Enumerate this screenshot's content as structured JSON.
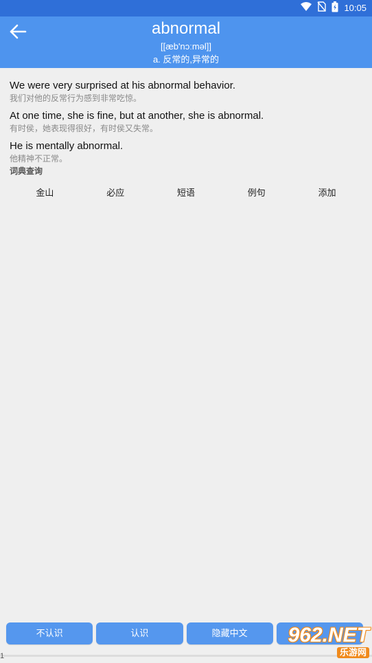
{
  "status_bar": {
    "time": "10:05",
    "icons": [
      "wifi-icon",
      "no-sim-icon",
      "battery-icon"
    ]
  },
  "header": {
    "word": "abnormal",
    "phonetic": "[[æb'nɔːməl]]",
    "definition": "a. 反常的,异常的"
  },
  "examples": [
    {
      "en": "We were very surprised at his abnormal behavior.",
      "zh": "我们对他的反常行为感到非常吃惊。"
    },
    {
      "en": "At one time, she is fine, but at another, she is abnormal.",
      "zh": "有时侯，她表现得很好，有时侯又失常。"
    },
    {
      "en": "He is mentally abnormal.",
      "zh": "他精神不正常。"
    }
  ],
  "dictionary": {
    "heading": "词典查询",
    "tabs": [
      "金山",
      "必应",
      "短语",
      "例句",
      "添加"
    ]
  },
  "bottom_buttons": [
    "不认识",
    "认识",
    "隐藏中文",
    ""
  ],
  "progress": {
    "start_label": "1"
  },
  "watermark": {
    "main": "962.NET",
    "sub": "乐游网"
  },
  "colors": {
    "status_bar": "#2f6fd8",
    "header": "#4e94ee",
    "button": "#5597ee",
    "background": "#efefef"
  }
}
